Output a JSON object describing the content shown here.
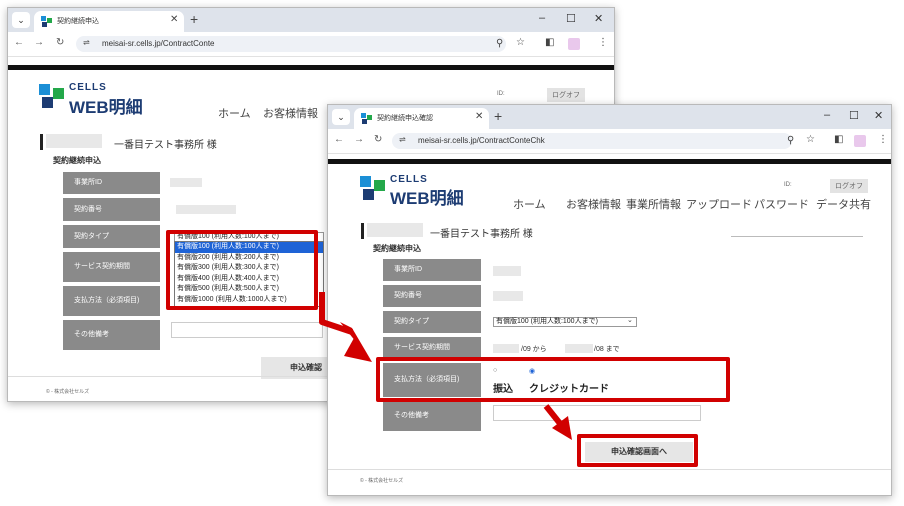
{
  "colors": {
    "annotation_red": "#d10000",
    "logo_blue": "#1d3c73",
    "label_gray": "#8a8a8a",
    "select_highlight": "#1e63d6"
  },
  "window1": {
    "tab_title": "契約継続申込",
    "url": "meisai-sr.cells.jp/ContractConte",
    "logo_cells": "CELLS",
    "logo_web": "WEB明細",
    "nav": [
      "ホーム",
      "お客様情報"
    ],
    "id_label": "ID:",
    "logout": "ログオフ",
    "customer": "一番目テスト事務所 様",
    "section": "契約継続申込",
    "labels": {
      "office_id": "事業所ID",
      "contract_no": "契約番号",
      "contract_type": "契約タイプ",
      "service_period": "サービス契約期間",
      "payment": "支払方法（必須項目)",
      "notes": "その他備考"
    },
    "select_value": "有償版100 (利用人数:100人まで)",
    "dropdown_options": [
      "有償版100 (利用人数:100人まで)",
      "有償版200 (利用人数:200人まで)",
      "有償版300 (利用人数:300人まで)",
      "有償版400 (利用人数:400人まで)",
      "有償版500 (利用人数:500人まで)",
      "有償版1000 (利用人数:1000人まで)"
    ],
    "submit": "申込確認",
    "footer": "©    - 株式会社セルズ"
  },
  "window2": {
    "tab_title": "契約継続申込確認",
    "url": "meisai-sr.cells.jp/ContractConteChk",
    "logo_cells": "CELLS",
    "logo_web": "WEB明細",
    "nav": [
      "ホーム",
      "お客様情報",
      "事業所情報",
      "アップロード",
      "パスワード",
      "データ共有"
    ],
    "id_label": "ID:",
    "logout": "ログオフ",
    "customer": "一番目テスト事務所 様",
    "section": "契約継続申込",
    "labels": {
      "office_id": "事業所ID",
      "contract_no": "契約番号",
      "contract_type": "契約タイプ",
      "service_period": "サービス契約期間",
      "payment": "支払方法（必須項目)",
      "notes": "その他備考"
    },
    "select_value": "有償版100 (利用人数:100人まで)",
    "period_from": "/09 から",
    "period_to": "/08 まで",
    "payment_options": [
      "振込",
      "クレジットカード"
    ],
    "payment_selected": "クレジットカード",
    "submit": "申込確認画面へ",
    "footer": "©    - 株式会社セルズ"
  }
}
